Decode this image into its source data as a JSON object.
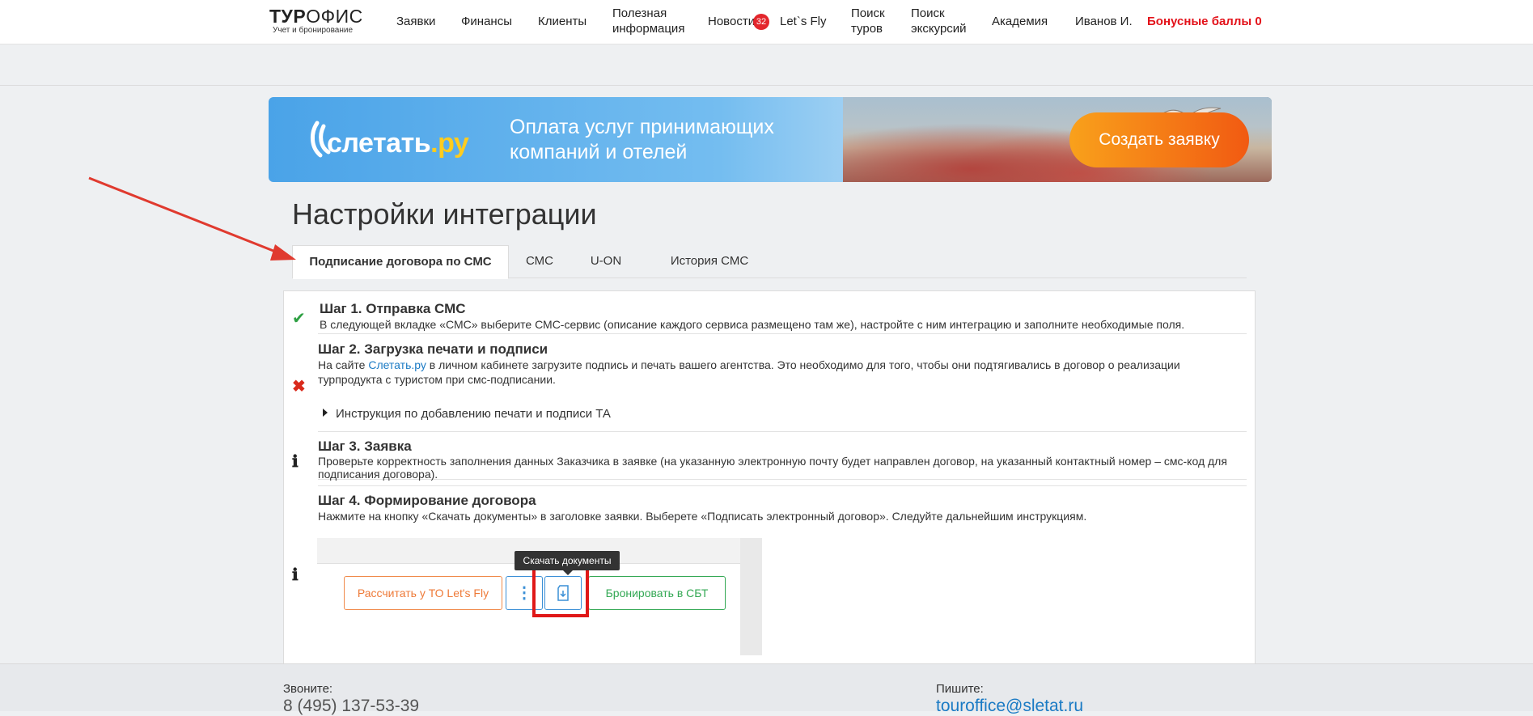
{
  "logo": {
    "main_bold": "ТУР",
    "main_rest": "ОФИС",
    "sub": "Учет и бронирование"
  },
  "nav": {
    "requests": "Заявки",
    "finance": "Финансы",
    "clients": "Клиенты",
    "info_line1": "Полезная",
    "info_line2": "информация",
    "news": "Новости",
    "news_count": "32",
    "letsfly": "Let`s Fly",
    "tours_line1": "Поиск",
    "tours_line2": "туров",
    "excursions_line1": "Поиск",
    "excursions_line2": "экскурсий",
    "academy": "Академия",
    "user": "Иванов И.",
    "bonus": "Бонусные баллы 0"
  },
  "banner": {
    "logo_text": "слетать",
    "logo_suffix": ".ру",
    "text": "Оплата услуг принимающих компаний и отелей",
    "button": "Создать заявку"
  },
  "page": {
    "title": "Настройки интеграции"
  },
  "tabs": [
    {
      "label": "Подписание договора по СМС",
      "active": true
    },
    {
      "label": "СМС",
      "active": false
    },
    {
      "label": "U-ON",
      "active": false
    },
    {
      "label": "История СМС",
      "active": false
    }
  ],
  "steps": {
    "s1": {
      "title": "Шаг 1. Отправка СМС",
      "status": "done",
      "text": "В следующей вкладке «СМС» выберите СМС-сервис (описание каждого сервиса размещено там же), настройте с ним интеграцию и заполните необходимые поля."
    },
    "s2": {
      "title": "Шаг 2. Загрузка печати и подписи",
      "status": "error",
      "text_before": "На сайте ",
      "link": "Слетать.ру",
      "text_after": " в личном кабинете загрузите подпись и печать вашего агентства. Это необходимо для того, чтобы они подтягивались в договор о реализации турпродукта с туристом при смс-подписании.",
      "details": "Инструкция по добавлению печати и подписи ТА"
    },
    "s3": {
      "title": "Шаг 3. Заявка",
      "status": "info",
      "text": "Проверьте корректность заполнения данных Заказчика в заявке (на указанную электронную почту будет направлен договор, на указанный контактный номер – смс-код для подписания договора)."
    },
    "s4": {
      "title": "Шаг 4. Формирование договора",
      "status": "info",
      "text": "Нажмите на кнопку «Скачать документы» в заголовке заявки. Выберете «Подписать электронный договор». Следуйте дальнейшим инструкциям."
    }
  },
  "illustration": {
    "tooltip": "Скачать документы",
    "btn_calc": "Рассчитать у ТО Let's Fly",
    "btn_menu": "⋮",
    "btn_book": "Бронировать в СБТ"
  },
  "footer": {
    "call_label": "Звоните:",
    "phone": "8 (495) 137-53-39",
    "write_label": "Пишите:",
    "email": "touroffice@sletat.ru"
  },
  "colors": {
    "accent": "#1a7ac4",
    "bonus": "#e3121a",
    "banner_btn": "#f15a12",
    "annotation": "#e03a2f"
  }
}
